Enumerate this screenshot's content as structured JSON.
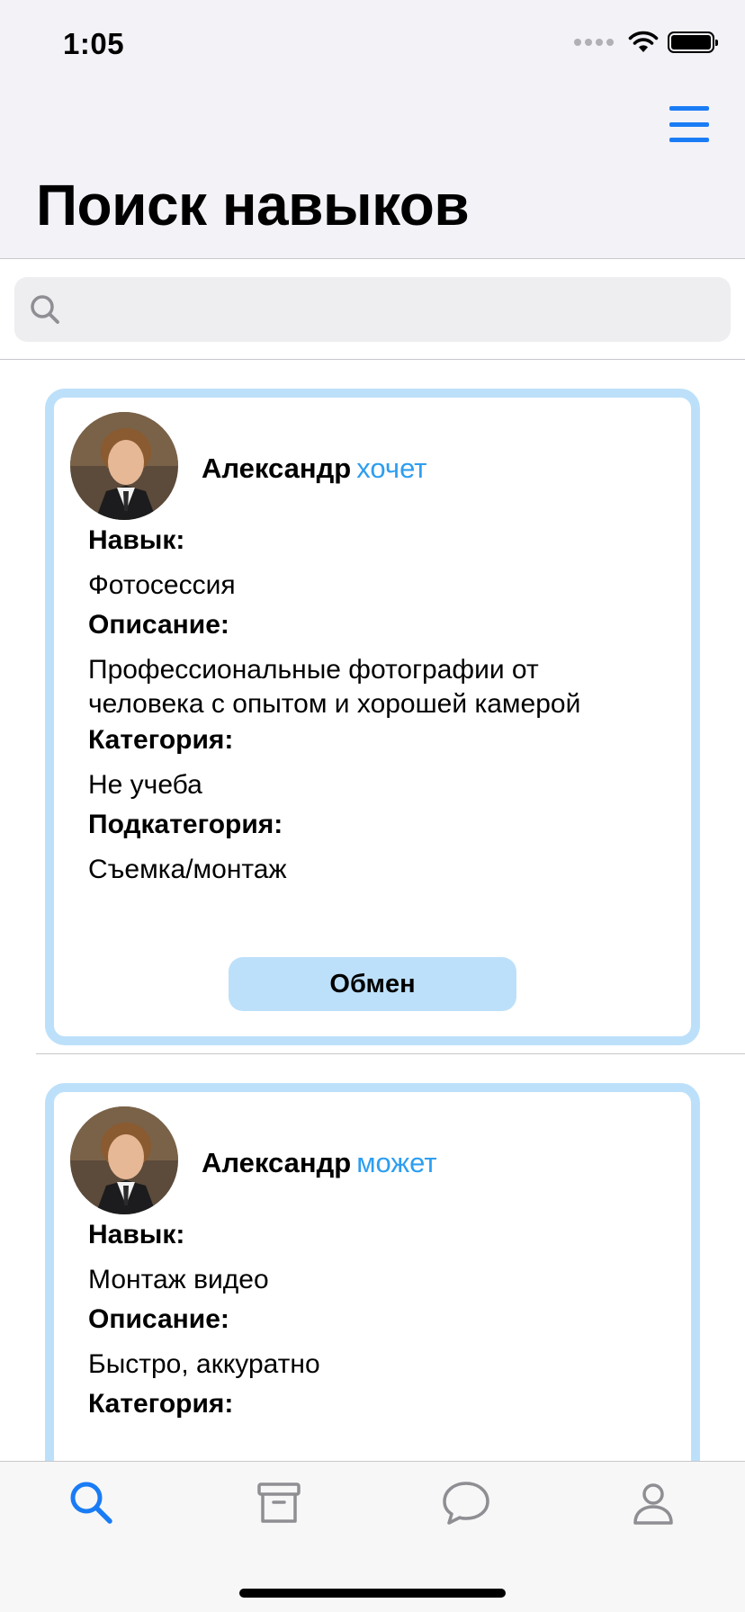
{
  "status_bar": {
    "time": "1:05"
  },
  "header": {
    "title": "Поиск навыков"
  },
  "search": {
    "placeholder": "",
    "value": ""
  },
  "cards": [
    {
      "user_name": "Александр",
      "verb": "хочет",
      "skill_label": "Навык:",
      "skill": "Фотосессия",
      "description_label": "Описание:",
      "description": "Профессиональные фотографии от человека с опытом и хорошей камерой",
      "category_label": "Категория:",
      "category": "Не учеба",
      "subcategory_label": "Подкатегория:",
      "subcategory": "Съемка/монтаж",
      "button_label": "Обмен"
    },
    {
      "user_name": "Александр",
      "verb": "может",
      "skill_label": "Навык:",
      "skill": "Монтаж видео",
      "description_label": "Описание:",
      "description": "Быстро, аккуратно",
      "category_label": "Категория:"
    }
  ],
  "tab_bar": {
    "tabs": [
      {
        "icon": "search-icon",
        "active": true
      },
      {
        "icon": "archive-icon",
        "active": false
      },
      {
        "icon": "chat-bubble-icon",
        "active": false
      },
      {
        "icon": "profile-icon",
        "active": false
      }
    ]
  },
  "colors": {
    "accent": "#1a7cf5",
    "verb_text": "#2d9ef0",
    "card_border": "#bde0fa",
    "inactive_icon": "#8e8e93"
  }
}
